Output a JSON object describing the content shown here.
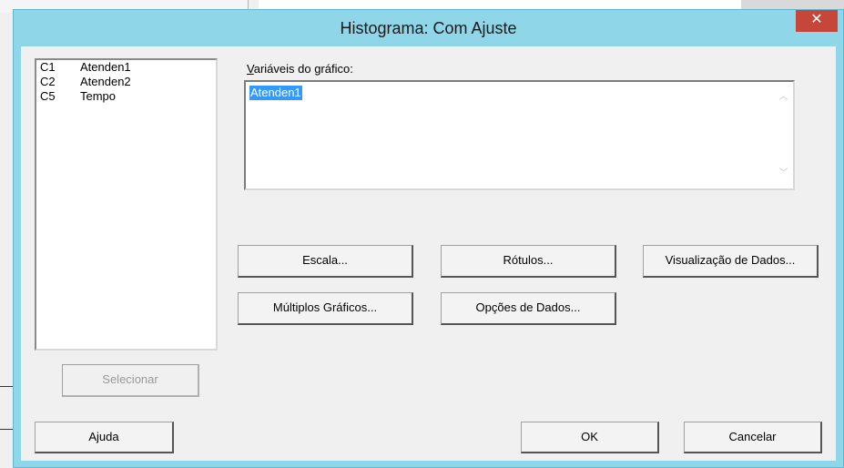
{
  "dialog": {
    "title": "Histograma: Com Ajuste",
    "close_glyph": "✕"
  },
  "variables": [
    {
      "id": "C1",
      "name": "Atenden1"
    },
    {
      "id": "C2",
      "name": "Atenden2"
    },
    {
      "id": "C5",
      "name": "Tempo"
    }
  ],
  "graph_variables": {
    "label": "Variáveis do gráfico:",
    "value": "Atenden1"
  },
  "buttons": {
    "escala": "Escala...",
    "rotulos": "Rótulos...",
    "visualizacao": "Visualização de Dados...",
    "multiplos": "Múltiplos Gráficos...",
    "opcoes": "Opções de Dados...",
    "selecionar": "Selecionar",
    "ajuda": "Ajuda",
    "ok": "OK",
    "cancelar": "Cancelar"
  },
  "icons": {
    "close": "close-icon",
    "scroll_up": "chevron-up-icon",
    "scroll_down": "chevron-down-icon"
  },
  "colors": {
    "title_bar": "#8fd6e8",
    "close_button": "#c7463a",
    "selection": "#3399ff"
  }
}
